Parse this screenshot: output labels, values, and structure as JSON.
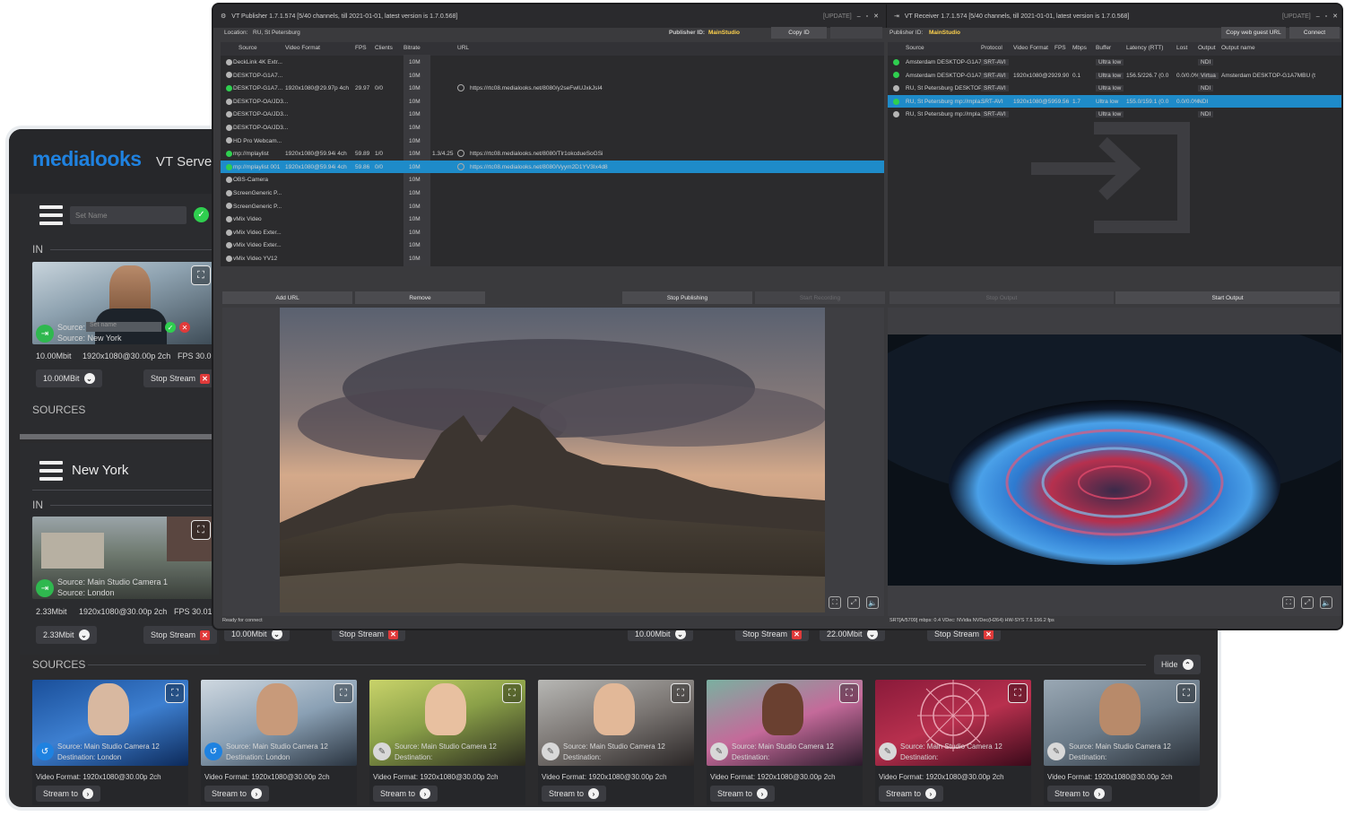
{
  "server": {
    "logo": "medialooks",
    "title": "VT Server /",
    "set_name_placeholder": "Set Name",
    "in_label": "IN",
    "sources_label": "SOURCES",
    "panel1": {
      "source_label": "Source:",
      "source_input_placeholder": "Set name",
      "source_line2": "Source: New York",
      "bitrate": "10.00Mbit",
      "format": "1920x1080@30.00p 2ch",
      "fps": "FPS 30.01",
      "bitrate_select": "10.00MBit",
      "stop_stream": "Stop Stream"
    },
    "panel2": {
      "name": "New York",
      "in_label": "IN",
      "source_line1": "Source: Main Studio Camera 1",
      "source_line2": "Source: London",
      "bitrate": "2.33Mbit",
      "format": "1920x1080@30.00p 2ch",
      "fps": "FPS 30.01",
      "bitrate_select": "2.33Mbit",
      "stop_stream": "Stop Stream"
    },
    "hidden_row": {
      "bitrate_a": "10.00Mbit",
      "stop_a": "Stop Stream",
      "bitrate_b": "10.00Mbit",
      "stop_b": "Stop Stream",
      "bitrate_c": "22.00Mbit",
      "stop_c": "Stop Stream"
    },
    "sources_bottom_label": "SOURCES",
    "hide_button": "Hide",
    "cards": [
      {
        "source": "Source: Main Studio Camera 12",
        "dest": "Destination: London",
        "format": "Video Format: 1920x1080@30.00p 2ch",
        "stream": "Stream to"
      },
      {
        "source": "Source: Main Studio Camera 12",
        "dest": "Destination: London",
        "format": "Video Format: 1920x1080@30.00p 2ch",
        "stream": "Stream to"
      },
      {
        "source": "Source: Main Studio Camera 12",
        "dest": "Destination:",
        "format": "Video Format: 1920x1080@30.00p 2ch",
        "stream": "Stream to"
      },
      {
        "source": "Source: Main Studio Camera 12",
        "dest": "Destination:",
        "format": "Video Format: 1920x1080@30.00p 2ch",
        "stream": "Stream to"
      },
      {
        "source": "Source: Main Studio Camera 12",
        "dest": "Destination:",
        "format": "Video Format: 1920x1080@30.00p 2ch",
        "stream": "Stream to"
      },
      {
        "source": "Source: Main Studio Camera 12",
        "dest": "Destination:",
        "format": "Video Format: 1920x1080@30.00p 2ch",
        "stream": "Stream to"
      },
      {
        "source": "Source: Main Studio Camera 12",
        "dest": "Destination:",
        "format": "Video Format: 1920x1080@30.00p 2ch",
        "stream": "Stream to"
      }
    ]
  },
  "publisher": {
    "title": "VT Publisher 1.7.1.574 [5/40 channels, till 2021-01-01, latest version is 1.7.0.568]",
    "update": "[UPDATE]",
    "location_label": "Location:",
    "location_value": "RU, St Petersburg",
    "publisher_id_label": "Publisher ID:",
    "publisher_id_value": "MainStudio",
    "copy_id": "Copy ID",
    "columns": [
      "Source",
      "Video Format",
      "FPS",
      "Clients",
      "Bitrate",
      "URL"
    ],
    "rows": [
      {
        "name": "DeckLink 4K Extr...",
        "format": "",
        "fps": "",
        "clients": "",
        "bitrate": "10M",
        "url": "",
        "active": false,
        "selected": false
      },
      {
        "name": "DESKTOP-G1A7...",
        "format": "",
        "fps": "",
        "clients": "",
        "bitrate": "10M",
        "url": "",
        "active": false,
        "selected": false
      },
      {
        "name": "DESKTOP-G1A7...",
        "format": "1920x1080@29.97p 4ch",
        "fps": "29.97",
        "clients": "0/0",
        "bitrate": "10M",
        "url": "https://rtc08.medialooks.net/8080/y2seFwlUJxkJsI4",
        "active": true,
        "selected": false
      },
      {
        "name": "DESKTOP-OA/JD3...",
        "format": "",
        "fps": "",
        "clients": "",
        "bitrate": "10M",
        "url": "",
        "active": false,
        "selected": false
      },
      {
        "name": "DESKTOP-OA/JD3...",
        "format": "",
        "fps": "",
        "clients": "",
        "bitrate": "10M",
        "url": "",
        "active": false,
        "selected": false
      },
      {
        "name": "DESKTOP-OA/JD3...",
        "format": "",
        "fps": "",
        "clients": "",
        "bitrate": "10M",
        "url": "",
        "active": false,
        "selected": false
      },
      {
        "name": "HD Pro Webcam...",
        "format": "",
        "fps": "",
        "clients": "",
        "bitrate": "10M",
        "url": "",
        "active": false,
        "selected": false
      },
      {
        "name": "mp://mplaylist",
        "format": "1920x1080@59.94i 4ch",
        "fps": "59.89",
        "clients": "1/0",
        "bitrate": "10M",
        "extra": "1.3/4.25",
        "url": "https://rtc08.medialooks.net/8080/Tlr1okcdueSoGSi",
        "active": true,
        "selected": false
      },
      {
        "name": "mp://mplaylist 001",
        "format": "1920x1080@59.94i 4ch",
        "fps": "59.86",
        "clients": "0/0",
        "bitrate": "10M",
        "url": "https://rtc08.medialooks.net/8080/Vyym2D1YV3Ix4d8",
        "active": true,
        "selected": true
      },
      {
        "name": "OBS-Camera",
        "format": "",
        "fps": "",
        "clients": "",
        "bitrate": "10M",
        "url": "",
        "active": false,
        "selected": false
      },
      {
        "name": "ScreenGeneric P...",
        "format": "",
        "fps": "",
        "clients": "",
        "bitrate": "10M",
        "url": "",
        "active": false,
        "selected": false
      },
      {
        "name": "ScreenGeneric P...",
        "format": "",
        "fps": "",
        "clients": "",
        "bitrate": "10M",
        "url": "",
        "active": false,
        "selected": false
      },
      {
        "name": "vMix Video",
        "format": "",
        "fps": "",
        "clients": "",
        "bitrate": "10M",
        "url": "",
        "active": false,
        "selected": false
      },
      {
        "name": "vMix Video Exter...",
        "format": "",
        "fps": "",
        "clients": "",
        "bitrate": "10M",
        "url": "",
        "active": false,
        "selected": false
      },
      {
        "name": "vMix Video Exter...",
        "format": "",
        "fps": "",
        "clients": "",
        "bitrate": "10M",
        "url": "",
        "active": false,
        "selected": false
      },
      {
        "name": "vMix Video YV12",
        "format": "",
        "fps": "",
        "clients": "",
        "bitrate": "10M",
        "url": "",
        "active": false,
        "selected": false
      }
    ],
    "buttons": {
      "add_url": "Add URL",
      "remove": "Remove",
      "stop_publishing": "Stop Publishing",
      "start_recording": "Start Recording"
    },
    "status": "Ready for connect"
  },
  "receiver": {
    "title": "VT Receiver 1.7.1.574 [5/40 channels, till 2021-01-01, latest version is 1.7.0.568]",
    "update": "[UPDATE]",
    "publisher_id_label": "Publisher ID:",
    "publisher_id_value": "MainStudio",
    "copy_guest_url": "Copy web guest URL",
    "connect": "Connect",
    "columns": [
      "Source",
      "Protocol",
      "Video Format",
      "FPS",
      "Mbps",
      "Buffer",
      "Latency (RTT)",
      "Lost",
      "Output",
      "Output name"
    ],
    "rows": [
      {
        "source": "Amsterdam DESKTOP-G1A7...",
        "protocol": "SRT-AVI",
        "format": "",
        "fps": "",
        "mbps": "",
        "buffer": "Ultra low",
        "latency": "",
        "lost": "",
        "output": "NDI",
        "output_name": "",
        "active": true,
        "selected": false
      },
      {
        "source": "Amsterdam DESKTOP-G1A7...",
        "protocol": "SRT-AVI",
        "format": "1920x1080@29",
        "fps": "29.90",
        "mbps": "0.1",
        "buffer": "Ultra low",
        "latency": "156.5/226.7 (0.0",
        "lost": "0.0/0.0%",
        "output": "Virtua",
        "output_name": "Amsterdam DESKTOP-G1A7MBU (t",
        "active": true,
        "selected": false
      },
      {
        "source": "RU, St Petersburg DESKTOP-...",
        "protocol": "SRT-AVI",
        "format": "",
        "fps": "",
        "mbps": "",
        "buffer": "Ultra low",
        "latency": "",
        "lost": "",
        "output": "NDI",
        "output_name": "",
        "active": false,
        "selected": false
      },
      {
        "source": "RU, St Petersburg mp://mpla...",
        "protocol": "SRT-AVI",
        "format": "1920x1080@59",
        "fps": "59.56",
        "mbps": "1.7",
        "buffer": "Ultra low",
        "latency": "155.0/159.1 (0.0",
        "lost": "0.0/0.0%",
        "output": "NDI",
        "output_name": "",
        "active": true,
        "selected": true
      },
      {
        "source": "RU, St Petersburg mp://mpla...",
        "protocol": "SRT-AVI",
        "format": "",
        "fps": "",
        "mbps": "",
        "buffer": "Ultra low",
        "latency": "",
        "lost": "",
        "output": "NDI",
        "output_name": "",
        "active": false,
        "selected": false
      }
    ],
    "buttons": {
      "stop_output": "Stop Output",
      "start_output": "Start Output"
    },
    "status": "SRT[A/5709] mbps: 0.4 VDec: NVidia NVDec(H264) HW-SYS 7.5 156.2 fps"
  },
  "colors": {
    "accent": "#1f82e0",
    "selected_row": "#1e8bc9",
    "green": "#2fcf4f",
    "red": "#e03a3a"
  },
  "icons": [
    "hamburger-icon",
    "check-icon",
    "close-icon",
    "fullscreen-icon",
    "chevron-down-icon",
    "chevron-up-icon",
    "source-icon",
    "import-arrow-icon",
    "mute-icon"
  ]
}
